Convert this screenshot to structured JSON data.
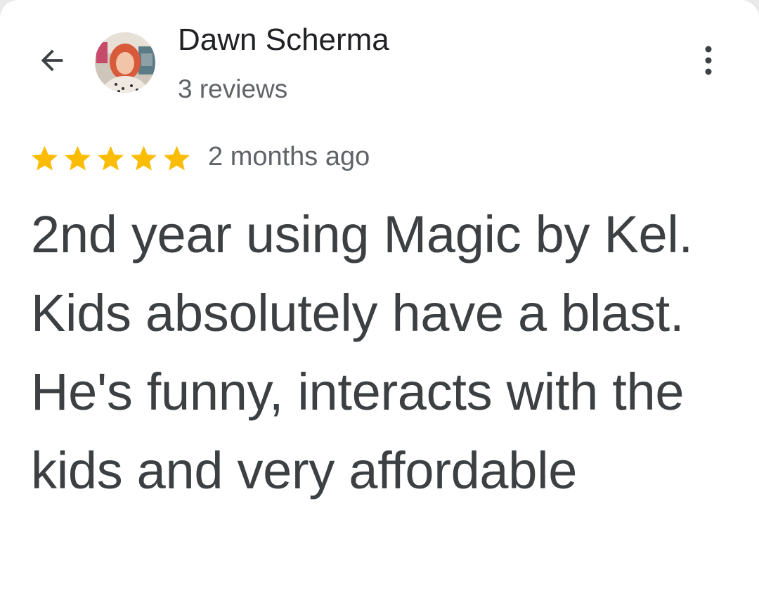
{
  "header": {
    "author_name": "Dawn Scherma",
    "review_count": "3 reviews",
    "back_icon": "arrow-back-icon",
    "more_icon": "more-vert-icon"
  },
  "review": {
    "rating": 5,
    "max_rating": 5,
    "star_color": "#fbbc04",
    "date": "2 months ago",
    "text": "2nd year using Magic by Kel. Kids absolutely have a blast. He's funny, interacts with the kids and very affordable"
  }
}
